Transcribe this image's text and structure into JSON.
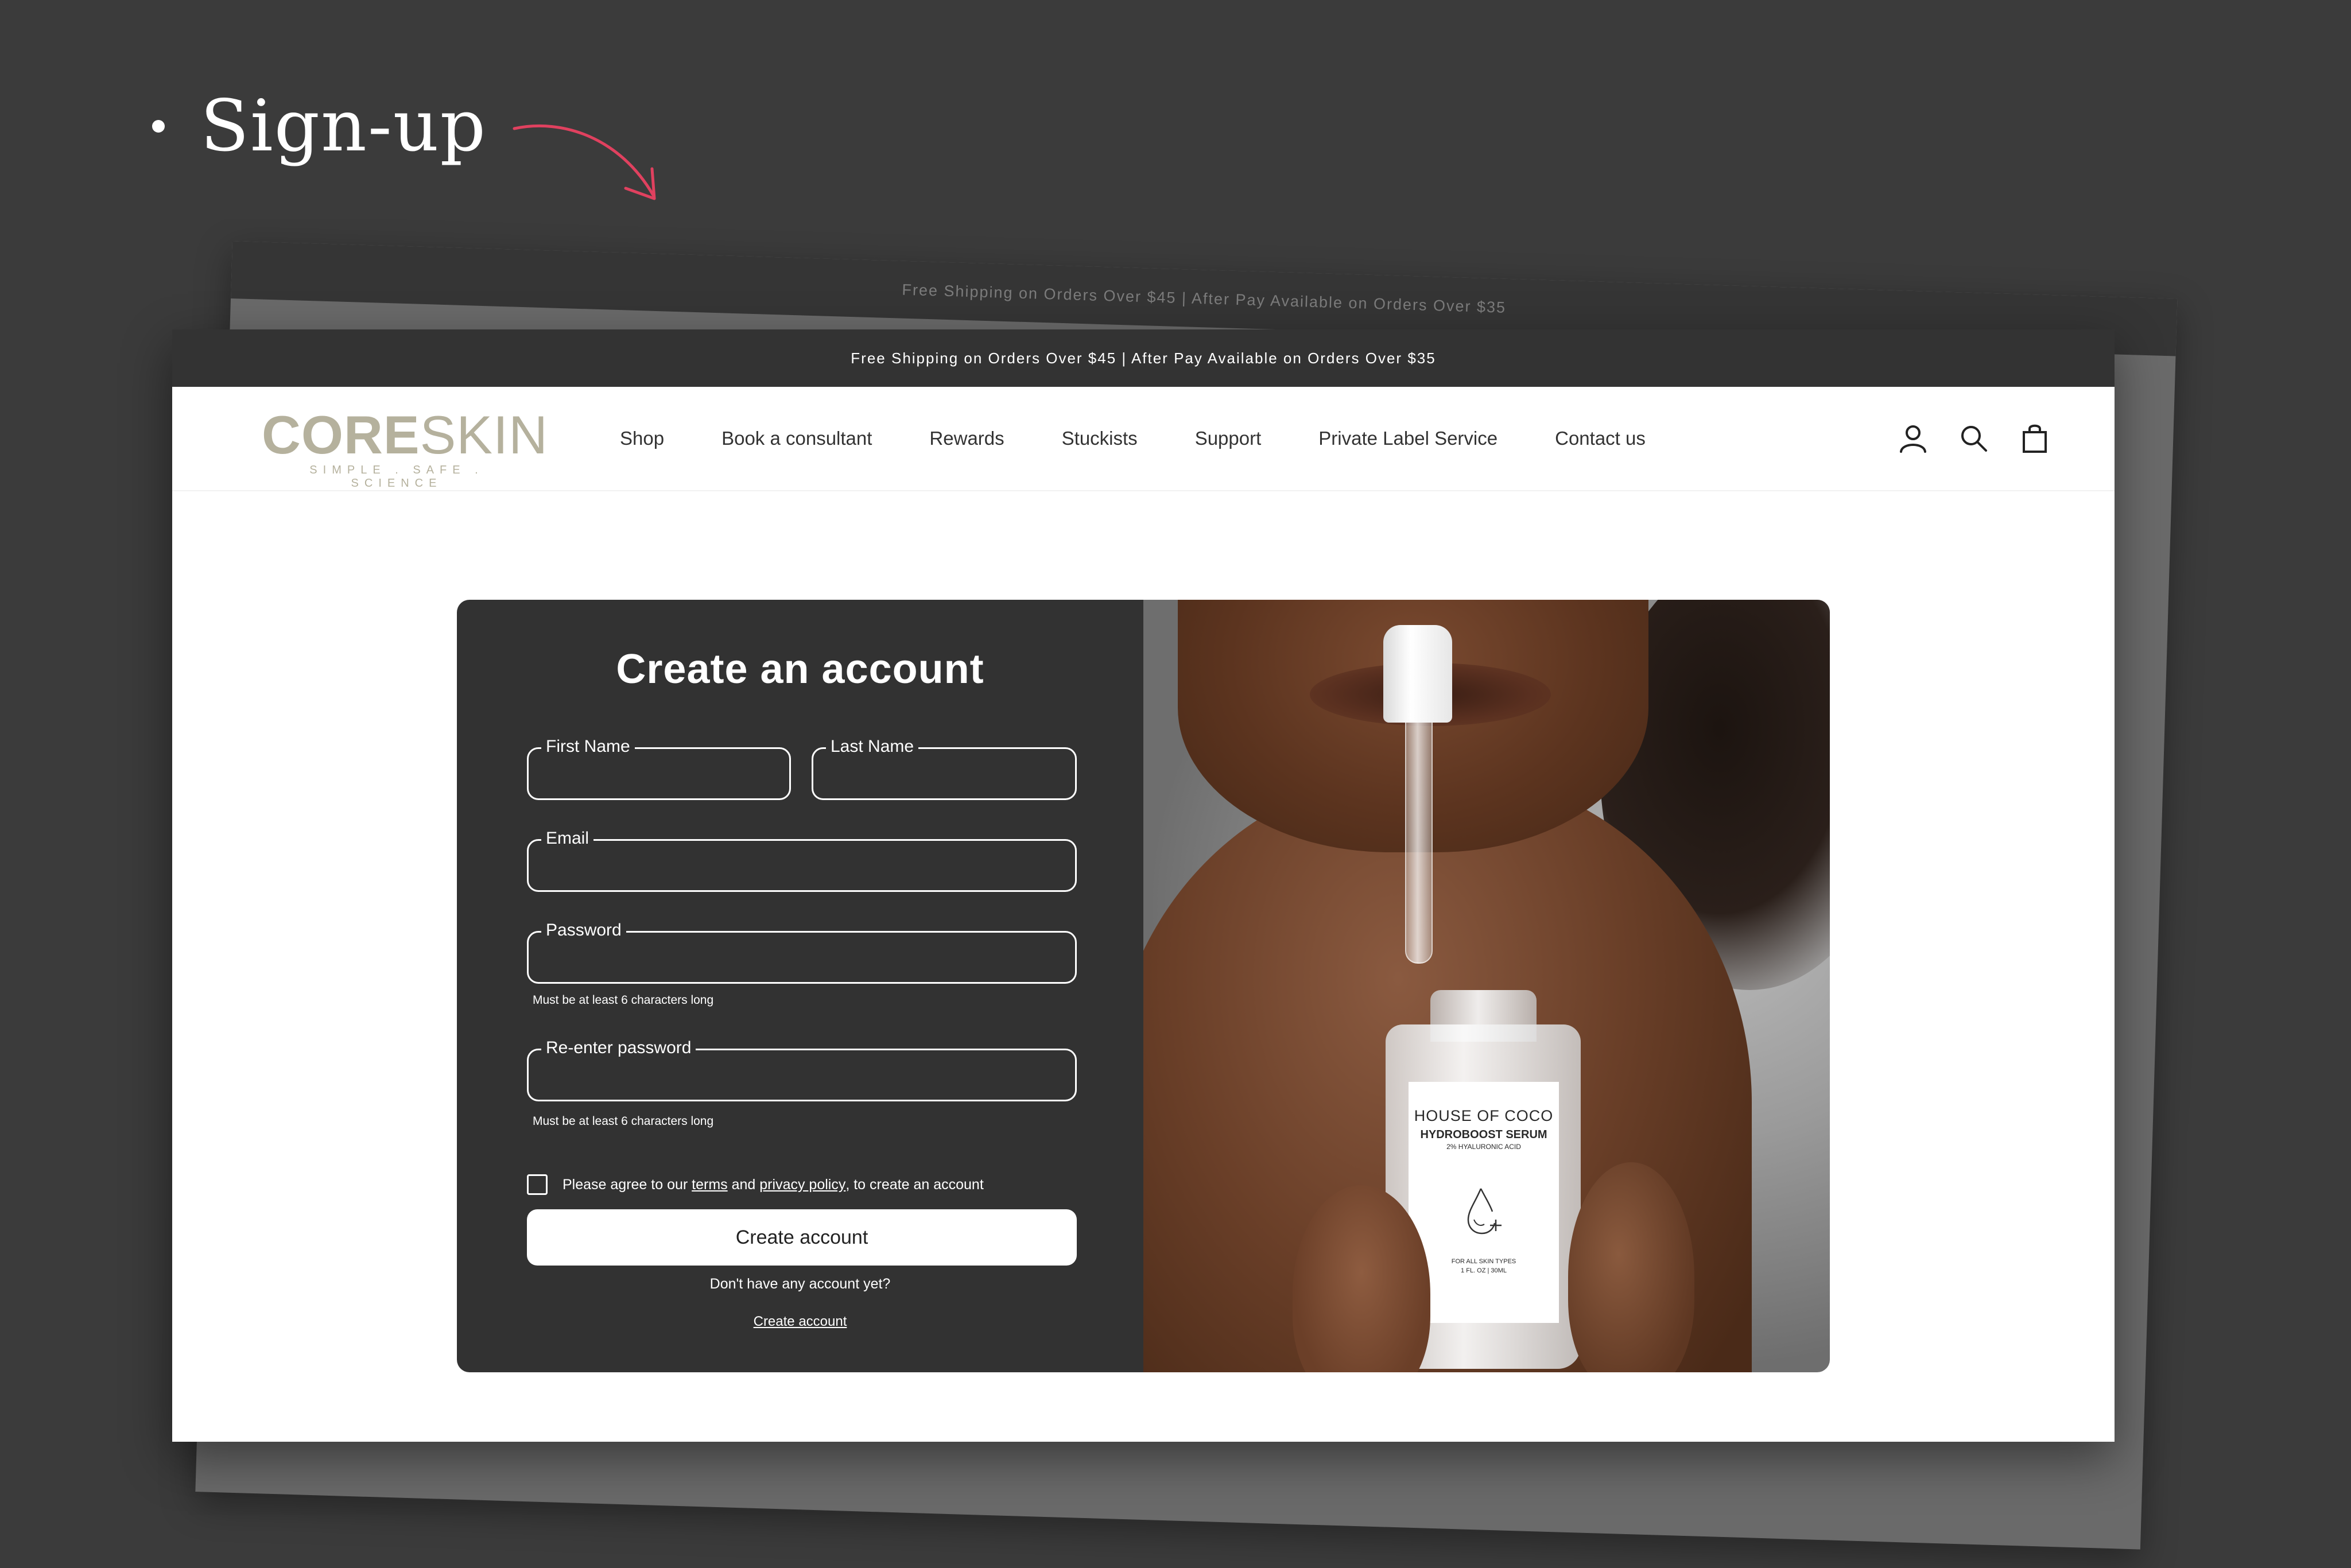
{
  "slide": {
    "title": "Sign-up",
    "accent_color": "#e0415f"
  },
  "back_card": {
    "announcement": "Free Shipping on Orders Over $45 | After Pay Available on Orders Over $35"
  },
  "site": {
    "announcement": "Free Shipping on Orders Over $45 | After Pay Available on Orders Over $35",
    "logo": {
      "bold": "CORE",
      "light": "SKIN",
      "tagline": "SIMPLE . SAFE . SCIENCE",
      "color": "#b5b19d"
    },
    "nav": [
      "Shop",
      "Book a consultant",
      "Rewards",
      "Stuckists",
      "Support",
      "Private Label Service",
      "Contact us"
    ],
    "icons": [
      "account-icon",
      "search-icon",
      "cart-bag-icon"
    ]
  },
  "form": {
    "title": "Create an account",
    "first_name_label": "First Name",
    "last_name_label": "Last Name",
    "email_label": "Email",
    "password_label": "Password",
    "password_hint": "Must be at least 6 characters long",
    "reenter_label": "Re-enter password",
    "reenter_hint": "Must be at least 6 characters long",
    "agree_prefix": "Please agree to our",
    "terms_link": "terms",
    "agree_and": "and",
    "privacy_link": "privacy policy",
    "agree_suffix": ", to create an account",
    "submit_label": "Create account",
    "no_account_text": "Don't have any account yet?",
    "create_link": "Create account"
  },
  "product": {
    "brand": "HOUSE OF COCO",
    "name": "HYDROBOOST SERUM",
    "sub": "2% HYALURONIC ACID",
    "foot_line1": "FOR ALL SKIN TYPES",
    "foot_line2": "1 FL. OZ  |  30ML"
  }
}
